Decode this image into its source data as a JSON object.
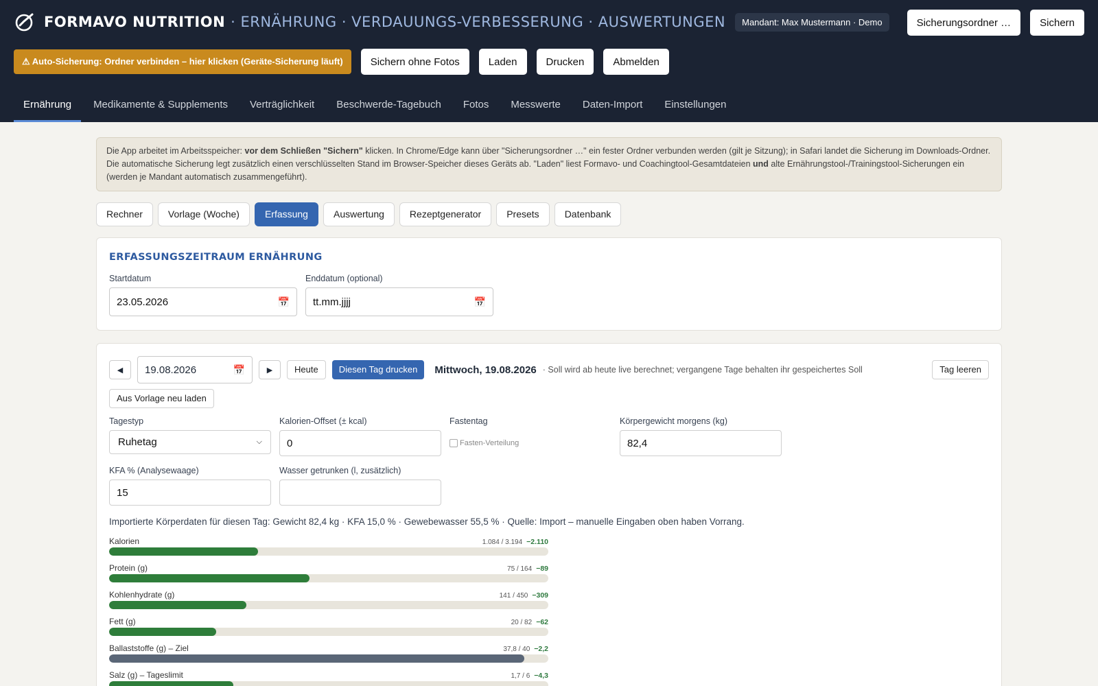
{
  "header": {
    "brand": "FORMAVO NUTRITION",
    "subtitle": "· ERNÄHRUNG · VERDAUUNGS-VERBESSERUNG · AUSWERTUNGEN",
    "mandant": "Mandant: Max Mustermann · Demo",
    "sicherungsordner_label": "Sicherungsordner …",
    "sichern_label": "Sichern"
  },
  "actions": {
    "warning": "⚠ Auto-Sicherung: Ordner verbinden – hier klicken (Geräte-Sicherung läuft)",
    "save_no_photos": "Sichern ohne Fotos",
    "load": "Laden",
    "print": "Drucken",
    "logout": "Abmelden"
  },
  "nav": [
    "Ernährung",
    "Medikamente & Supplements",
    "Verträglichkeit",
    "Beschwerde-Tagebuch",
    "Fotos",
    "Messwerte",
    "Daten-Import",
    "Einstellungen"
  ],
  "info": {
    "p1": "Die App arbeitet im Arbeitsspeicher: ",
    "b1": "vor dem Schließen \"Sichern\"",
    "p2": " klicken. In Chrome/Edge kann über \"Sicherungsordner …\" ein fester Ordner verbunden werden (gilt je Sitzung); in Safari landet die Sicherung im Downloads-Ordner. Die automatische Sicherung legt zusätzlich einen verschlüsselten Stand im Browser-Speicher dieses Geräts ab. \"Laden\" liest Formavo- und Coachingtool-Gesamtdateien ",
    "b2": "und",
    "p3": " alte Ernährungstool-/Trainingstool-Sicherungen ein (werden je Mandant automatisch zusammengeführt)."
  },
  "subtabs": [
    "Rechner",
    "Vorlage (Woche)",
    "Erfassung",
    "Auswertung",
    "Rezeptgenerator",
    "Presets",
    "Datenbank"
  ],
  "period": {
    "title": "ERFASSUNGSZEITRAUM ERNÄHRUNG",
    "start_label": "Startdatum",
    "start_value": "23.05.2026",
    "end_label": "Enddatum (optional)",
    "end_value": "tt.mm.jjjj"
  },
  "day": {
    "date": "19.08.2026",
    "today": "Heute",
    "print_day": "Diesen Tag drucken",
    "title": "Mittwoch, 19.08.2026",
    "hint": "· Soll wird ab heute live berechnet; vergangene Tage behalten ihr gespeichertes Soll",
    "clear": "Tag leeren",
    "reload": "Aus Vorlage neu laden"
  },
  "form": {
    "tagestyp_label": "Tagestyp",
    "tagestyp_value": "Ruhetag",
    "offset_label": "Kalorien-Offset (± kcal)",
    "offset_value": "0",
    "fasten_label": "Fastentag",
    "fasten_check": "Fasten-Verteilung",
    "weight_label": "Körpergewicht morgens (kg)",
    "weight_value": "82,4",
    "kfa_label": "KFA % (Analysewaage)",
    "kfa_value": "15",
    "water_label": "Wasser getrunken (l, zusätzlich)",
    "water_value": ""
  },
  "imported": "Importierte Körperdaten für diesen Tag: Gewicht 82,4 kg · KFA 15,0 % · Gewebewasser 55,5 % · Quelle: Import – manuelle Eingaben oben haben Vorrang.",
  "bars": [
    {
      "label": "Kalorien",
      "nums": "1.084 / 3.194",
      "diff": "−2.110",
      "fraction": 0.339,
      "color": "green"
    },
    {
      "label": "Protein (g)",
      "nums": "75 / 164",
      "diff": "−89",
      "fraction": 0.457,
      "color": "green"
    },
    {
      "label": "Kohlenhydrate (g)",
      "nums": "141 / 450",
      "diff": "−309",
      "fraction": 0.313,
      "color": "green"
    },
    {
      "label": "Fett (g)",
      "nums": "20 / 82",
      "diff": "−62",
      "fraction": 0.244,
      "color": "green"
    },
    {
      "label": "Ballaststoffe (g) – Ziel",
      "nums": "37,8 / 40",
      "diff": "−2,2",
      "fraction": 0.945,
      "color": "gray"
    },
    {
      "label": "Salz (g) – Tageslimit",
      "nums": "1,7 / 6",
      "diff": "−4,3",
      "fraction": 0.283,
      "color": "green"
    }
  ],
  "colors": {
    "header_bg": "#1b2333",
    "accent": "#3566b0",
    "warning": "#c98a1e",
    "bar_green": "#2e7d3a",
    "bar_gray": "#5a6677"
  }
}
